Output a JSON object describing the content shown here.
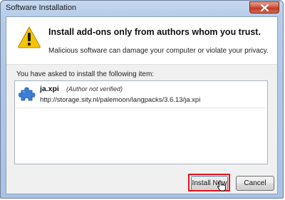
{
  "window": {
    "title": "Software Installation"
  },
  "header": {
    "heading": "Install add-ons only from authors whom you trust.",
    "subtext": "Malicious software can damage your computer or violate your privacy."
  },
  "main": {
    "asked_text": "You have asked to install the following item:",
    "items": [
      {
        "name": "ja.xpi",
        "note": "(Author not verified)",
        "url": "http://storage.sity.nl/palemoon/langpacks/3.6.13/ja.xpi",
        "icon": "puzzle-piece-icon"
      }
    ]
  },
  "buttons": {
    "install_label": "Install Now",
    "cancel_label": "Cancel"
  },
  "icons": {
    "warning": "warning-icon",
    "close": "close-icon",
    "cursor": "hand-pointer-icon"
  },
  "colors": {
    "highlight": "#e8141c",
    "close_button": "#c03a23",
    "warning_yellow": "#f5c400",
    "puzzle_blue": "#3a7fd4"
  }
}
